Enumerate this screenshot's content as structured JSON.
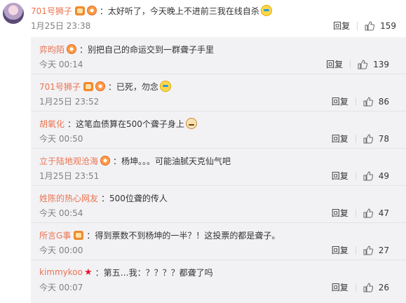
{
  "main_comment": {
    "username": "701号狮子",
    "text": "：太好听了，今天晚上不进前三我在线自杀",
    "time": "1月25日 23:38",
    "reply_label": "回复",
    "like_count": "159"
  },
  "replies": [
    {
      "username": "弈昀陌",
      "text": "：别把自己的命运交到一群聋子手里",
      "time": "今天 00:14",
      "reply_label": "回复",
      "like_count": "139"
    },
    {
      "username": "701号狮子",
      "text": "：已死，勿念",
      "time": "1月25日 23:52",
      "reply_label": "回复",
      "like_count": "86"
    },
    {
      "username": "胡氧化",
      "text": "：这笔血债算在500个聋子身上",
      "time": "今天 00:50",
      "reply_label": "回复",
      "like_count": "78"
    },
    {
      "username": "立于陆地观沧海",
      "text": "：杨坤。。。可能油腻天克仙气吧",
      "time": "1月25日 23:51",
      "reply_label": "回复",
      "like_count": "49"
    },
    {
      "username": "姓陈的热心网友",
      "text": "：500位聋的传人",
      "time": "今天 00:54",
      "reply_label": "回复",
      "like_count": "47"
    },
    {
      "username": "所言G事",
      "text": "：得到票数不到杨坤的一半？！这投票的都是聋子。",
      "time": "今天 00:00",
      "reply_label": "回复",
      "like_count": "27"
    },
    {
      "username": "kimmykoo",
      "text": "：第五…我：？？？？都聋了吗",
      "time": "今天 00:07",
      "reply_label": "回复",
      "like_count": "26"
    }
  ],
  "colors": {
    "username": "#eb7350",
    "panel_bg": "#f2f2f5",
    "meta": "#808080"
  },
  "icons": {
    "like": "thumbs-up-icon",
    "vip": "vip-badge-icon",
    "member": "member-badge-icon",
    "star": "star-icon"
  }
}
